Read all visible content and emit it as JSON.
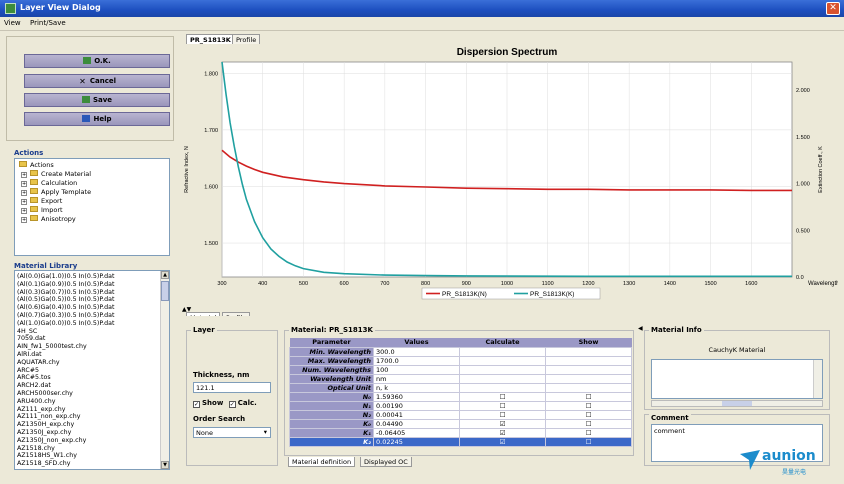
{
  "window": {
    "title": "Layer View Dialog",
    "close_glyph": "✕"
  },
  "menu": [
    "View",
    "Print/Save"
  ],
  "buttons": {
    "ok": "O.K.",
    "cancel": "Cancel",
    "save": "Save",
    "help": "Help"
  },
  "actions": {
    "title": "Actions",
    "root": "Actions",
    "items": [
      "Create Material",
      "Calculation",
      "Apply Template",
      "Export",
      "Import",
      "Anisotropy"
    ]
  },
  "library": {
    "title": "Material Library",
    "items": [
      "(Al(0.0)Ga(1.0))0.5 In(0.5)P.dat",
      "(Al(0.1)Ga(0.9))0.5 In(0.5)P.dat",
      "(Al(0.3)Ga(0.7))0.5 In(0.5)P.dat",
      "(Al(0.5)Ga(0.5))0.5 In(0.5)P.dat",
      "(Al(0.6)Ga(0.4))0.5 In(0.5)P.dat",
      "(Al(0.7)Ga(0.3))0.5 In(0.5)P.dat",
      "(Al(1.0)Ga(0.0))0.5 In(0.5)P.dat",
      "4H_SC",
      "7059.dat",
      "AIN_fw1_5000test.chy",
      "AlRI.dat",
      "AQUATAR.chy",
      "ARC#5",
      "ARC#5.tos",
      "ARCH2.dat",
      "ARCH5000ser.chy",
      "ARU400.chy",
      "AZ111_exp.chy",
      "AZ111_non_exp.chy",
      "AZ1350H_exp.chy",
      "AZ1350J_exp.chy",
      "AZ1350J_non_exp.chy",
      "AZ1518.chy",
      "AZ1518HS_W1.chy",
      "AZ1518_SFD.chy"
    ]
  },
  "top_tabs": [
    "PR_S1813K",
    "Profile"
  ],
  "lower_tabs": [
    "Material",
    "Profile"
  ],
  "bottom_tabs": [
    "Material definition",
    "Displayed OC"
  ],
  "chart_data": {
    "type": "line",
    "title": "Dispersion Spectrum",
    "xlabel": "Wavelength, nm",
    "ylabel": "Refractive Index, N",
    "y2label": "Extinction Coeff., K",
    "xlim": [
      300,
      1700
    ],
    "ylim": [
      1.44,
      1.82
    ],
    "y2lim": [
      0.0,
      2.3
    ],
    "xticks": [
      300,
      400,
      500,
      600,
      700,
      800,
      900,
      1000,
      1100,
      1200,
      1300,
      1400,
      1500,
      1600
    ],
    "yticks": [
      "1.500",
      "1.600",
      "1.700",
      "1.800"
    ],
    "y2ticks": [
      "0.0",
      "0.500",
      "1.000",
      "1.500",
      "2.000"
    ],
    "grid": true,
    "legend": "bottom",
    "series": [
      {
        "name": "PR_S1813K(N)",
        "color": "#d02020",
        "axis": "left",
        "x": [
          300,
          320,
          340,
          360,
          380,
          400,
          450,
          500,
          550,
          600,
          700,
          800,
          900,
          1000,
          1100,
          1200,
          1300,
          1400,
          1500,
          1600,
          1700
        ],
        "y": [
          1.664,
          1.652,
          1.643,
          1.636,
          1.63,
          1.625,
          1.617,
          1.612,
          1.608,
          1.605,
          1.601,
          1.599,
          1.597,
          1.596,
          1.595,
          1.595,
          1.594,
          1.594,
          1.594,
          1.593,
          1.593
        ]
      },
      {
        "name": "PR_S1813K(K)",
        "color": "#20a0a0",
        "axis": "right",
        "x": [
          300,
          310,
          320,
          330,
          340,
          350,
          360,
          380,
          400,
          420,
          440,
          460,
          480,
          500,
          550,
          600,
          700,
          800,
          900,
          1000,
          1100,
          1200,
          1300,
          1400,
          1500,
          1600,
          1700
        ],
        "y": [
          2.3,
          1.95,
          1.65,
          1.4,
          1.18,
          0.99,
          0.83,
          0.59,
          0.42,
          0.3,
          0.22,
          0.16,
          0.12,
          0.09,
          0.05,
          0.035,
          0.02,
          0.015,
          0.012,
          0.01,
          0.009,
          0.008,
          0.008,
          0.007,
          0.007,
          0.007,
          0.007
        ]
      }
    ]
  },
  "layer": {
    "title": "Layer",
    "thickness_label": "Thickness, nm",
    "thickness_value": "121.1",
    "show_label": "Show",
    "calc_label": "Calc.",
    "order_label": "Order Search",
    "order_value": "None"
  },
  "material": {
    "title": "Material: PR_S1813K",
    "headers": [
      "Parameter",
      "Values",
      "Calculate",
      "Show"
    ],
    "rows": [
      {
        "param": "Min. Wavelength",
        "value": "300.0",
        "calc": "",
        "show": ""
      },
      {
        "param": "Max. Wavelength",
        "value": "1700.0",
        "calc": "",
        "show": ""
      },
      {
        "param": "Num. Wavelengths",
        "value": "100",
        "calc": "",
        "show": ""
      },
      {
        "param": "Wavelength Unit",
        "value": "nm",
        "calc": "",
        "show": ""
      },
      {
        "param": "Optical Unit",
        "value": "n, k",
        "calc": "",
        "show": ""
      },
      {
        "param": "N₀",
        "value": "1.59360",
        "calc": "☐",
        "show": "☐"
      },
      {
        "param": "N₁",
        "value": "0.00190",
        "calc": "☐",
        "show": "☐"
      },
      {
        "param": "N₂",
        "value": "0.00041",
        "calc": "☐",
        "show": "☐"
      },
      {
        "param": "K₀",
        "value": "0.04490",
        "calc": "☑",
        "show": "☐"
      },
      {
        "param": "K₁",
        "value": "-0.06405",
        "calc": "☑",
        "show": "☐"
      },
      {
        "param": "K₂",
        "value": "0.02245",
        "calc": "☑",
        "show": "☐"
      }
    ]
  },
  "material_info": {
    "title": "Material Info",
    "value": "CauchyK Material"
  },
  "comment": {
    "title": "Comment",
    "value": "comment"
  },
  "logo": {
    "name": "aunion",
    "sub": "昊量光电",
    "color": "#1c8ccc"
  }
}
